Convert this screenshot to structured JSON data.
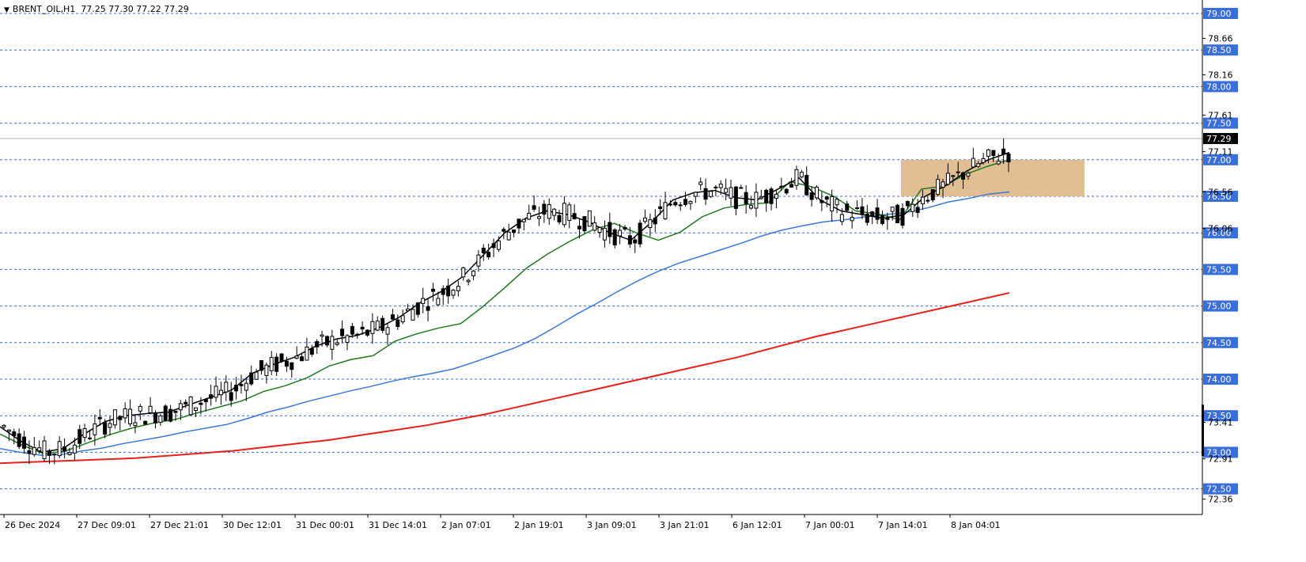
{
  "header": {
    "symbol": "BRENT_OIL,H1",
    "ohlc": "77.25 77.30 77.22 77.29"
  },
  "chart_data": {
    "type": "candlestick",
    "title": "BRENT_OIL,H1",
    "y_axis": {
      "min": 72.2,
      "max": 79.2,
      "level_labels": [
        "79.00",
        "78.50",
        "78.00",
        "77.50",
        "77.00",
        "76.50",
        "76.00",
        "75.50",
        "75.00",
        "74.50",
        "74.00",
        "73.50",
        "73.00",
        "72.50"
      ],
      "plain_labels": [
        "78.66",
        "78.16",
        "77.61",
        "77.11",
        "76.56",
        "76.06",
        "73.41",
        "72.91",
        "72.36"
      ],
      "current_price": "77.29"
    },
    "x_axis": {
      "time_labels": [
        "26 Dec 2024",
        "27 Dec 09:01",
        "27 Dec 21:01",
        "30 Dec 12:01",
        "31 Dec 00:01",
        "31 Dec 14:01",
        "2 Jan 07:01",
        "2 Jan 19:01",
        "3 Jan 09:01",
        "3 Jan 21:01",
        "6 Jan 12:01",
        "7 Jan 00:01",
        "7 Jan 14:01",
        "8 Jan 04:01"
      ]
    },
    "grid": "horizontal dashed at each 0.50 level",
    "zone": {
      "from": 76.5,
      "to": 77.0,
      "color": "#deb887"
    },
    "colors": {
      "grid": "#3a6ed8",
      "ma_fast": "#000000",
      "ma_mid": "#1e7a1e",
      "ma_slow": "#3c78d8",
      "ma_long": "#e8201a",
      "label_bg": "#3a6ed8",
      "current_bg": "#000000"
    },
    "ma_long": [
      72.85,
      72.86,
      72.87,
      72.88,
      72.89,
      72.9,
      72.91,
      72.92,
      72.94,
      72.96,
      72.98,
      73.0,
      73.02,
      73.05,
      73.08,
      73.11,
      73.14,
      73.17,
      73.21,
      73.25,
      73.29,
      73.33,
      73.37,
      73.42,
      73.47,
      73.52,
      73.58,
      73.64,
      73.7,
      73.76,
      73.82,
      73.88,
      73.94,
      74.0,
      74.06,
      74.12,
      74.18,
      74.24,
      74.3,
      74.37,
      74.44,
      74.51,
      74.58,
      74.64,
      74.7,
      74.76,
      74.82,
      74.88,
      74.94,
      75.0,
      75.06,
      75.12,
      75.18
    ],
    "ma_slow": [
      73.05,
      73.0,
      72.96,
      72.97,
      73.02,
      73.06,
      73.12,
      73.17,
      73.22,
      73.28,
      73.33,
      73.38,
      73.46,
      73.55,
      73.62,
      73.7,
      73.77,
      73.84,
      73.9,
      73.97,
      74.03,
      74.08,
      74.14,
      74.23,
      74.33,
      74.43,
      74.56,
      74.72,
      74.89,
      75.04,
      75.2,
      75.35,
      75.48,
      75.59,
      75.68,
      75.77,
      75.86,
      75.96,
      76.04,
      76.1,
      76.15,
      76.18,
      76.22,
      76.25,
      76.28,
      76.34,
      76.42,
      76.47,
      76.53,
      76.56
    ],
    "ma_mid": [
      73.25,
      73.1,
      72.98,
      73.02,
      73.13,
      73.24,
      73.33,
      73.4,
      73.45,
      73.54,
      73.62,
      73.7,
      73.83,
      73.91,
      74.02,
      74.18,
      74.27,
      74.32,
      74.52,
      74.62,
      74.7,
      74.76,
      74.99,
      75.25,
      75.52,
      75.72,
      75.89,
      76.04,
      76.13,
      76.0,
      75.9,
      76.01,
      76.22,
      76.34,
      76.39,
      76.41,
      76.7,
      76.63,
      76.5,
      76.3,
      76.26,
      76.18,
      76.6,
      76.64,
      76.8,
      76.91,
      77.0
    ],
    "ma_fast": [
      73.35,
      73.15,
      73.0,
      73.05,
      73.25,
      73.42,
      73.5,
      73.53,
      73.55,
      73.65,
      73.75,
      73.85,
      74.08,
      74.2,
      74.3,
      74.45,
      74.55,
      74.6,
      74.7,
      74.85,
      75.05,
      75.2,
      75.4,
      75.7,
      76.0,
      76.2,
      76.3,
      76.25,
      76.15,
      76.0,
      75.9,
      76.15,
      76.45,
      76.55,
      76.58,
      76.48,
      76.45,
      76.6,
      76.75,
      76.45,
      76.3,
      76.25,
      76.2,
      76.25,
      76.5,
      76.65,
      76.85,
      77.0,
      77.1
    ]
  }
}
